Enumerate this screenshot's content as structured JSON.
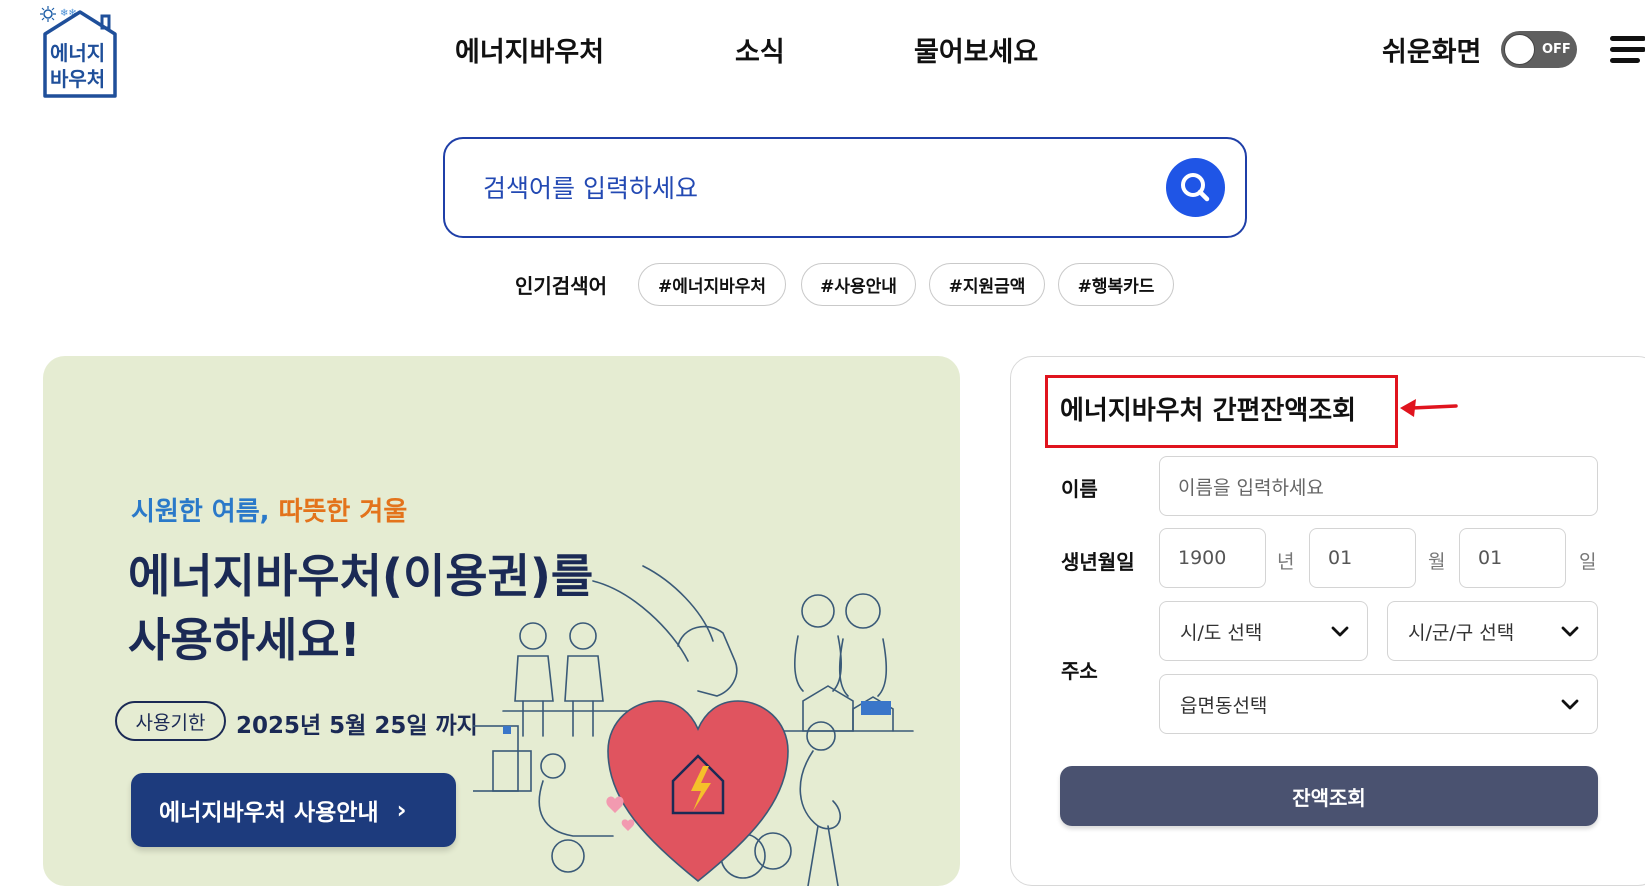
{
  "header": {
    "logo_text_line1": "에너지",
    "logo_text_line2": "바우처",
    "nav": [
      "에너지바우처",
      "소식",
      "물어보세요"
    ],
    "easy_screen_label": "쉬운화면",
    "toggle_state": "OFF"
  },
  "search": {
    "placeholder": "검색어를 입력하세요"
  },
  "popular": {
    "label": "인기검색어",
    "tags": [
      "#에너지바우처",
      "#사용안내",
      "#지원금액",
      "#행복카드"
    ]
  },
  "banner": {
    "subtitle_part1": "시원한 여름,",
    "subtitle_part2": "따뜻한 겨울",
    "title_line1": "에너지바우처(이용권)를",
    "title_line2": "사용하세요!",
    "badge": "사용기한",
    "expire_date": "2025년 5월 25일 까지",
    "guide_button": "에너지바우처 사용안내",
    "guide_chevron": "›",
    "colors": {
      "background": "#e5ecd2",
      "accent_blue": "#2a79c9",
      "accent_orange": "#e3731b",
      "button": "#1d3b7d"
    }
  },
  "balance_panel": {
    "title": "에너지바우처 간편잔액조회",
    "name_label": "이름",
    "name_placeholder": "이름을 입력하세요",
    "birth_label": "생년월일",
    "birth_year": "1900",
    "birth_year_unit": "년",
    "birth_month": "01",
    "birth_month_unit": "월",
    "birth_day": "01",
    "birth_day_unit": "일",
    "address_label": "주소",
    "sido_select": "시/도 선택",
    "sigungu_select": "시/군/구 선택",
    "eupmyeondong_select": "읍면동선택",
    "lookup_button": "잔액조회",
    "colors": {
      "highlight_box": "#e0141e",
      "button": "#4a5270"
    }
  }
}
